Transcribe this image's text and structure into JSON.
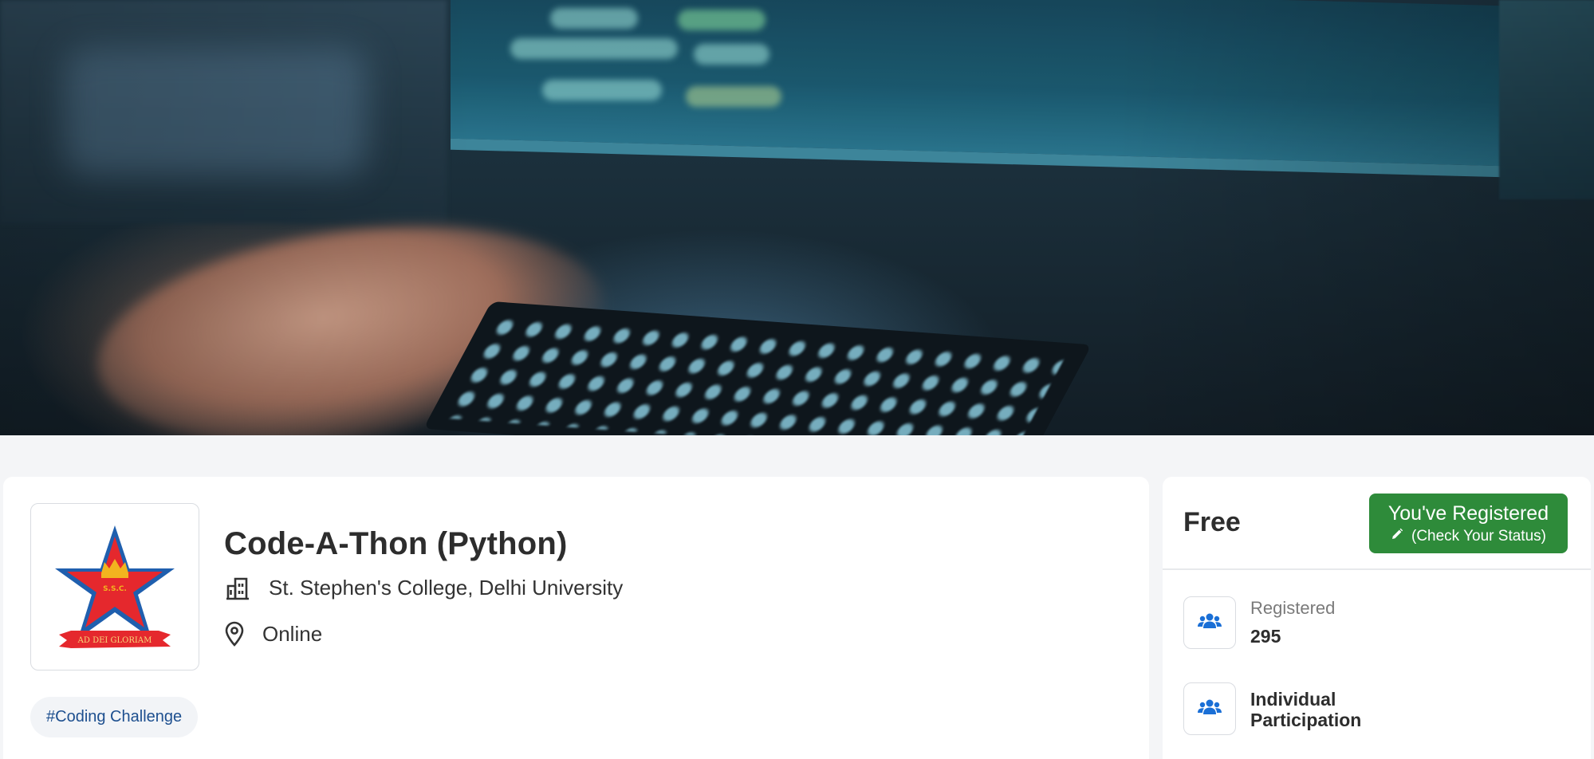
{
  "banner": {
    "image": "person-typing-code-at-computer"
  },
  "event": {
    "logo_icon": "college-crest-icon",
    "logo_motto": "AD DEI GLORIAM",
    "logo_initials": "S.S.C.",
    "title": "Code-A-Thon (Python)",
    "organization": "St. Stephen's College, Delhi University",
    "location": "Online",
    "tag": "#Coding Challenge"
  },
  "sidebar": {
    "price": "Free",
    "register_button": {
      "label": "You've Registered",
      "sub_label": "(Check Your Status)",
      "color": "#2e8b3a"
    },
    "stats": [
      {
        "icon": "users-icon",
        "label": "Registered",
        "value": "295"
      },
      {
        "icon": "users-icon",
        "value_line1": "Individual",
        "value_line2": "Participation"
      }
    ]
  },
  "colors": {
    "accent_blue": "#1a6fd6",
    "tag_text": "#1d4f8f",
    "page_bg": "#f4f5f7"
  }
}
